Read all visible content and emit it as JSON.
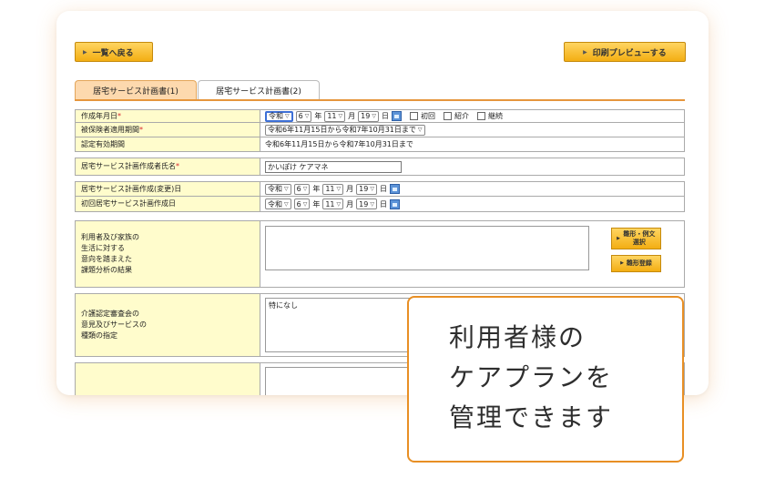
{
  "toolbar": {
    "back_label": "一覧へ戻る",
    "print_label": "印刷プレビューする"
  },
  "tabs": [
    {
      "label": "居宅サービス計画書(1)",
      "active": true
    },
    {
      "label": "居宅サービス計画書(2)",
      "active": false
    }
  ],
  "form": {
    "created_date": {
      "label": "作成年月日",
      "era": "令和",
      "year": "6",
      "month": "11",
      "day": "19",
      "year_unit": "年",
      "month_unit": "月",
      "day_unit": "日",
      "checkboxes": [
        "初回",
        "紹介",
        "継続"
      ]
    },
    "insured_period": {
      "label": "被保険者適用期間",
      "value": "令和6年11月15日から令和7年10月31日まで"
    },
    "certification_period": {
      "label": "認定有効期間",
      "value": "令和6年11月15日から令和7年10月31日まで"
    },
    "creator_name": {
      "label": "居宅サービス計画作成者氏名",
      "value": "かいぽけ ケアマネ"
    },
    "changed_date": {
      "label": "居宅サービス計画作成(変更)日",
      "era": "令和",
      "year": "6",
      "month": "11",
      "day": "19"
    },
    "first_date": {
      "label": "初回居宅サービス計画作成日",
      "era": "令和",
      "year": "6",
      "month": "11",
      "day": "19"
    },
    "intent": {
      "label_lines": [
        "利用者及び家族の",
        "生活に対する",
        "意向を踏まえた",
        "課題分析の結果"
      ],
      "value": "",
      "template_btn": "雛形・例文選択",
      "register_btn": "雛形登録"
    },
    "committee": {
      "label_lines": [
        "介護認定審査会の",
        "意見及びサービスの",
        "種類の指定"
      ],
      "value": "特になし"
    }
  },
  "callout": {
    "lines": [
      "利用者様の",
      "ケアプランを",
      "管理できます"
    ],
    "accent_color": "#e88f24"
  }
}
